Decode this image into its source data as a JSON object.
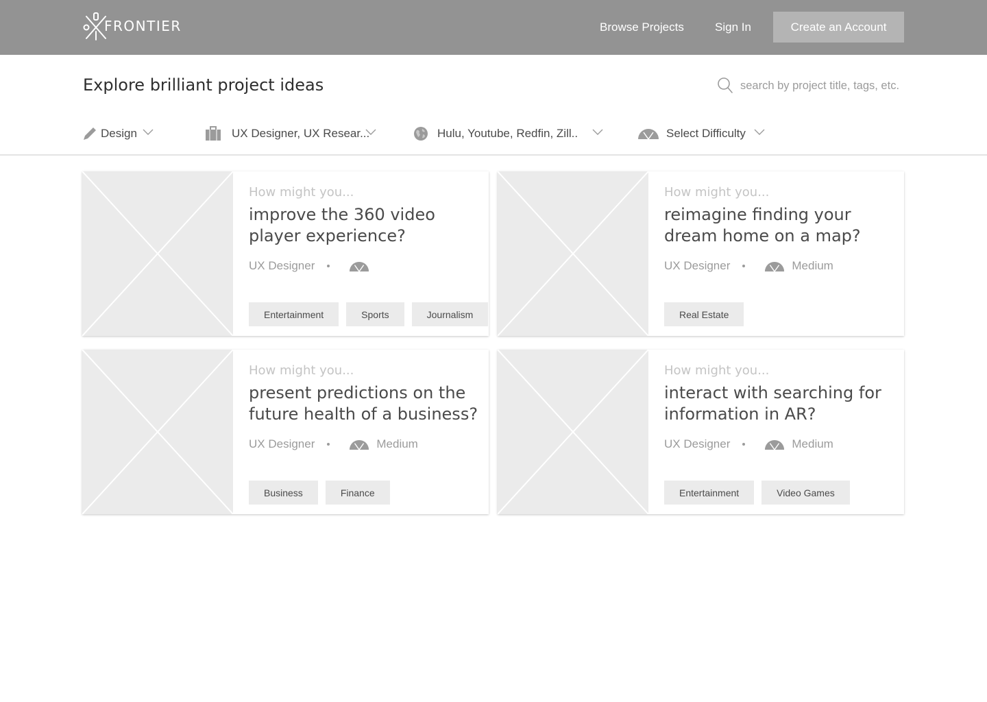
{
  "header": {
    "logo_text": "FRONTIER",
    "nav": {
      "browse": "Browse Projects",
      "sign_in": "Sign In"
    },
    "cta": "Create an Account"
  },
  "page": {
    "title": "Explore brilliant project ideas",
    "search": {
      "placeholder": "search by project title, tags, etc.",
      "value": ""
    }
  },
  "filters": [
    {
      "icon": "pencil-icon",
      "label": "Design"
    },
    {
      "icon": "briefcase-icon",
      "label": "UX Designer, UX Resear..."
    },
    {
      "icon": "globe-icon",
      "label": "Hulu, Youtube, Redfin, Zill.."
    },
    {
      "icon": "speedometer-icon",
      "label": "Select Difficulty"
    }
  ],
  "cards": [
    {
      "prompt": "How might you...",
      "title": "improve the 360 video player experience?",
      "role": "UX Designer",
      "difficulty": "",
      "tags": [
        "Entertainment",
        "Sports",
        "Journalism"
      ]
    },
    {
      "prompt": "How might you...",
      "title": "reimagine finding your dream home on a map?",
      "role": "UX Designer",
      "difficulty": "Medium",
      "tags": [
        "Real Estate"
      ]
    },
    {
      "prompt": "How might you...",
      "title": "present predictions on the future health of a business?",
      "role": "UX Designer",
      "difficulty": "Medium",
      "tags": [
        "Business",
        "Finance"
      ]
    },
    {
      "prompt": "How might you...",
      "title": "interact with searching for information in AR?",
      "role": "UX Designer",
      "difficulty": "Medium",
      "tags": [
        "Entertainment",
        "Video Games"
      ]
    }
  ],
  "colors": {
    "header_bg": "#939393",
    "cta_bg": "#b4b4b4",
    "tag_bg": "#ebebeb",
    "placeholder_bg": "#ebebeb"
  }
}
